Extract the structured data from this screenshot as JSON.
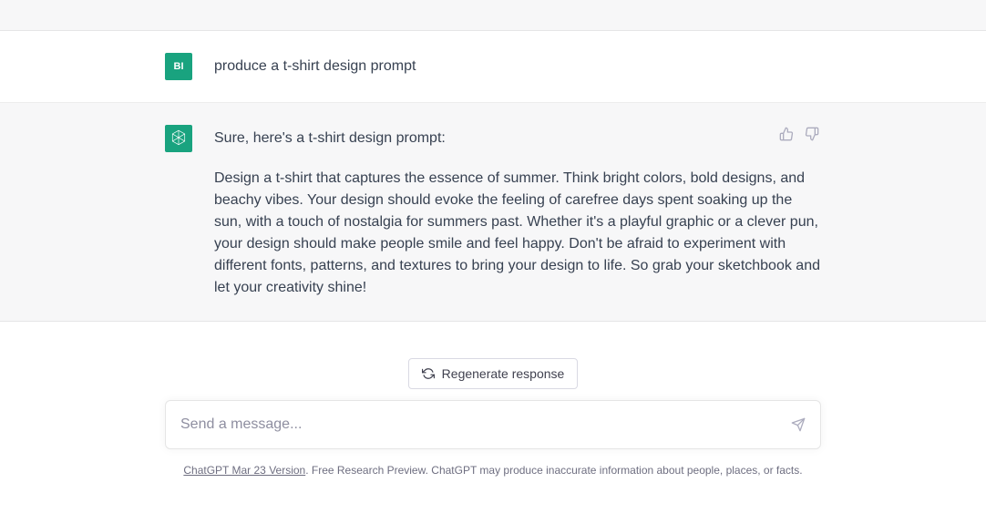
{
  "user": {
    "avatar_text": "BI",
    "message": "produce a t-shirt design prompt"
  },
  "assistant": {
    "intro": "Sure, here's a t-shirt design prompt:",
    "body": "Design a t-shirt that captures the essence of summer. Think bright colors, bold designs, and beachy vibes. Your design should evoke the feeling of carefree days spent soaking up the sun, with a touch of nostalgia for summers past. Whether it's a playful graphic or a clever pun, your design should make people smile and feel happy. Don't be afraid to experiment with different fonts, patterns, and textures to bring your design to life. So grab your sketchbook and let your creativity shine!"
  },
  "controls": {
    "regenerate": "Regenerate response",
    "input_placeholder": "Send a message..."
  },
  "footer": {
    "version": "ChatGPT Mar 23 Version",
    "disclaimer": ". Free Research Preview. ChatGPT may produce inaccurate information about people, places, or facts."
  }
}
